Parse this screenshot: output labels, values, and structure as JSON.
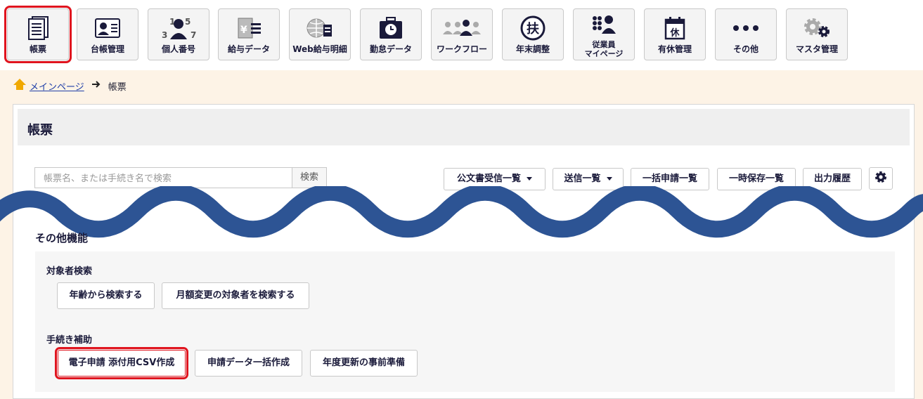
{
  "nav": {
    "items": [
      {
        "label": "帳票",
        "icon": "document-list-icon"
      },
      {
        "label": "台帳管理",
        "icon": "id-card-icon"
      },
      {
        "label": "個人番号",
        "icon": "person-number-icon"
      },
      {
        "label": "給与データ",
        "icon": "yen-document-icon"
      },
      {
        "label": "Web給与明細",
        "icon": "globe-document-icon"
      },
      {
        "label": "勤怠データ",
        "icon": "clock-briefcase-icon"
      },
      {
        "label": "ワークフロー",
        "icon": "people-flow-icon"
      },
      {
        "label": "年末調整",
        "icon": "fu-circle-icon"
      },
      {
        "label": "従業員\nマイページ",
        "icon": "employee-icon"
      },
      {
        "label": "有休管理",
        "icon": "calendar-rest-icon"
      },
      {
        "label": "その他",
        "icon": "more-dots-icon"
      },
      {
        "label": "マスタ管理",
        "icon": "gears-icon"
      }
    ]
  },
  "breadcrumb": {
    "home": "メインページ",
    "current": "帳票"
  },
  "page": {
    "title": "帳票"
  },
  "search": {
    "placeholder": "帳票名、または手続き名で検索",
    "button": "検索"
  },
  "toolbar": {
    "official_docs": "公文書受信一覧",
    "sent_list": "送信一覧",
    "batch_list": "一括申請一覧",
    "temp_saved": "一時保存一覧",
    "output_history": "出力履歴"
  },
  "other": {
    "title": "その他機能",
    "target_search": {
      "title": "対象者検索",
      "by_age": "年齢から検索する",
      "monthly_change": "月額変更の対象者を検索する"
    },
    "procedure_help": {
      "title": "手続き補助",
      "csv_create": "電子申請 添付用CSV作成",
      "batch_create": "申請データ一括作成",
      "annual_prep": "年度更新の事前準備"
    }
  },
  "colors": {
    "accent_red": "#e0141e",
    "navy": "#1a1a3a",
    "wave": "#2d5494",
    "page_bg": "#fdf3e6"
  }
}
